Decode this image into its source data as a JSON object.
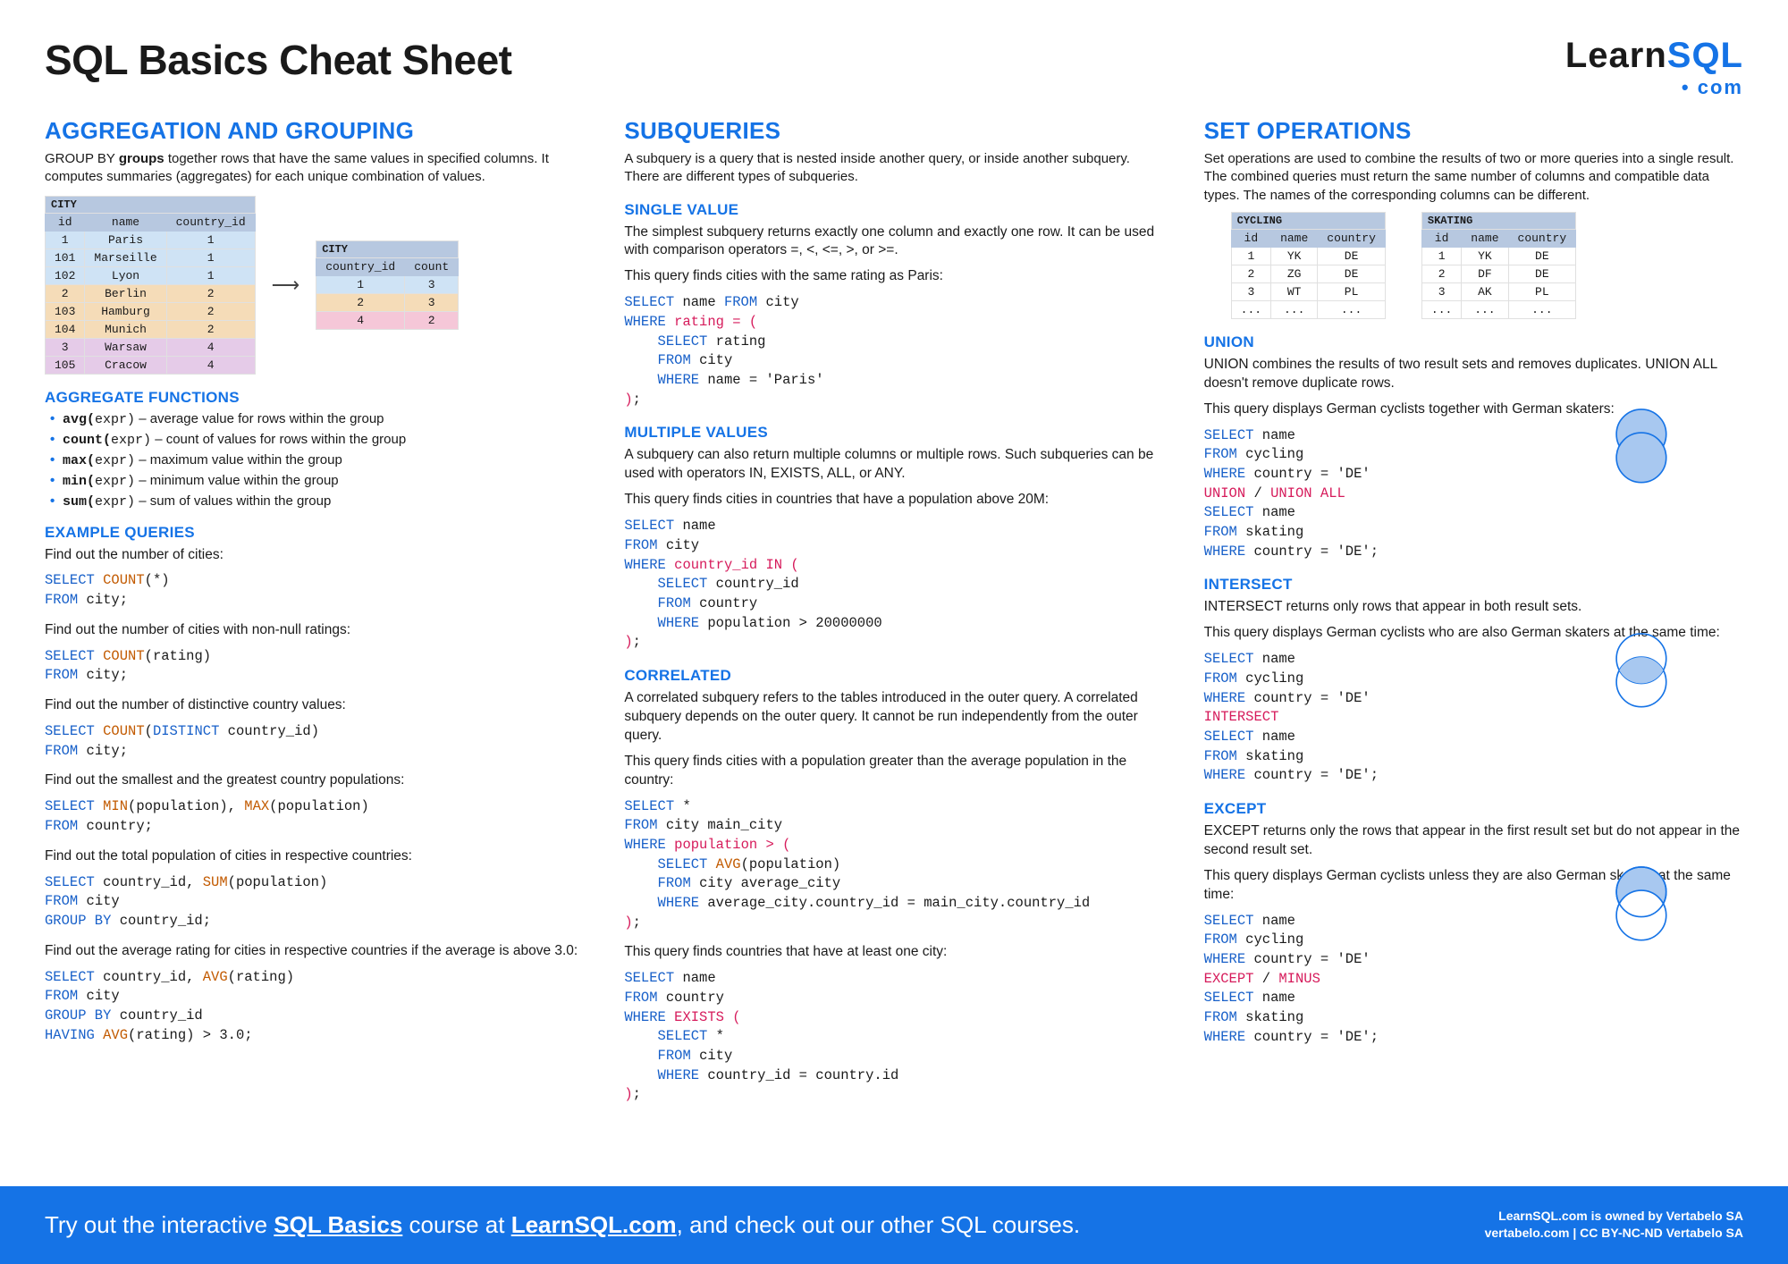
{
  "title": "SQL Basics Cheat Sheet",
  "logo": {
    "learn": "Learn",
    "sql": "SQL",
    "dot": "•",
    "com": "com"
  },
  "col1": {
    "h2": "AGGREGATION AND GROUPING",
    "intro": "GROUP BY groups together rows that have the same values in specified columns. It computes summaries (aggregates) for each unique combination of values.",
    "table_city_title": "CITY",
    "city_headers": [
      "id",
      "name",
      "country_id"
    ],
    "city_rows": [
      [
        "1",
        "Paris",
        "1"
      ],
      [
        "101",
        "Marseille",
        "1"
      ],
      [
        "102",
        "Lyon",
        "1"
      ],
      [
        "2",
        "Berlin",
        "2"
      ],
      [
        "103",
        "Hamburg",
        "2"
      ],
      [
        "104",
        "Munich",
        "2"
      ],
      [
        "3",
        "Warsaw",
        "4"
      ],
      [
        "105",
        "Cracow",
        "4"
      ]
    ],
    "agg_title": "CITY",
    "agg_headers": [
      "country_id",
      "count"
    ],
    "agg_rows": [
      [
        "1",
        "3"
      ],
      [
        "2",
        "3"
      ],
      [
        "4",
        "2"
      ]
    ],
    "h3_funcs": "AGGREGATE FUNCTIONS",
    "funcs": [
      {
        "fn": "avg(",
        "arg": "expr)",
        "desc": " – average value for rows within the group"
      },
      {
        "fn": "count(",
        "arg": "expr)",
        "desc": " – count of values for rows within the group"
      },
      {
        "fn": "max(",
        "arg": "expr)",
        "desc": " – maximum value within the group"
      },
      {
        "fn": "min(",
        "arg": "expr)",
        "desc": " – minimum value within the group"
      },
      {
        "fn": "sum(",
        "arg": "expr)",
        "desc": " – sum of values within the group"
      }
    ],
    "h3_ex": "EXAMPLE QUERIES",
    "q1_label": "Find out the number of cities:",
    "q2_label": "Find out the number of cities with non-null ratings:",
    "q3_label": "Find out the number of distinctive country values:",
    "q4_label": "Find out the smallest and the greatest country populations:",
    "q5_label": "Find out the total population of cities in respective countries:",
    "q6_label": "Find out the average rating for cities in respective countries if the average is above 3.0:"
  },
  "col2": {
    "h2": "SUBQUERIES",
    "intro": "A subquery is a query that is nested inside another query, or inside another subquery. There are different types of subqueries.",
    "h3_single": "SINGLE VALUE",
    "single_p1": "The simplest subquery returns exactly one column and exactly one row. It can be used with comparison operators =, <, <=, >, or >=.",
    "single_p2": "This query finds cities with the same rating as Paris:",
    "h3_multi": "MULTIPLE VALUES",
    "multi_p1": "A subquery can also return multiple columns or multiple rows. Such subqueries can be used with operators IN, EXISTS, ALL, or ANY.",
    "multi_p2": "This query finds cities in countries that have a population above 20M:",
    "h3_corr": "CORRELATED",
    "corr_p1": "A correlated subquery refers to the tables introduced in the outer query. A correlated subquery depends on the outer query. It cannot be run independently from the outer query.",
    "corr_p2": "This query finds cities with a population greater than the average population in the country:",
    "corr_p3": "This query finds countries that have at least one city:"
  },
  "col3": {
    "h2": "SET OPERATIONS",
    "intro": "Set operations are used to combine the results of two or more queries into a single result. The combined queries must return the same number of columns and compatible data types. The names of the corresponding columns can be different.",
    "cycling_title": "CYCLING",
    "skating_title": "SKATING",
    "set_headers": [
      "id",
      "name",
      "country"
    ],
    "cycling_rows": [
      [
        "1",
        "YK",
        "DE"
      ],
      [
        "2",
        "ZG",
        "DE"
      ],
      [
        "3",
        "WT",
        "PL"
      ],
      [
        "...",
        "...",
        "..."
      ]
    ],
    "skating_rows": [
      [
        "1",
        "YK",
        "DE"
      ],
      [
        "2",
        "DF",
        "DE"
      ],
      [
        "3",
        "AK",
        "PL"
      ],
      [
        "...",
        "...",
        "..."
      ]
    ],
    "h3_union": "UNION",
    "union_p1": "UNION combines the results of two result sets and removes duplicates. UNION ALL doesn't remove duplicate rows.",
    "union_p2": "This query displays German cyclists together with German skaters:",
    "h3_intersect": "INTERSECT",
    "intersect_p1": "INTERSECT returns only rows that appear in both result sets.",
    "intersect_p2": "This query displays German cyclists who are also German skaters at the same time:",
    "h3_except": "EXCEPT",
    "except_p1": "EXCEPT returns only the rows that appear in the first result set but do not appear in the second result set.",
    "except_p2": "This query displays German cyclists unless they are also German skaters at the same time:"
  },
  "footer": {
    "left1": "Try out the interactive ",
    "left_u1": "SQL Basics",
    "left2": " course at ",
    "left_u2": "LearnSQL.com",
    "left3": ", and check out our other SQL courses.",
    "right1": "LearnSQL.com is owned by Vertabelo SA",
    "right2": "vertabelo.com | CC BY-NC-ND Vertabelo SA"
  }
}
